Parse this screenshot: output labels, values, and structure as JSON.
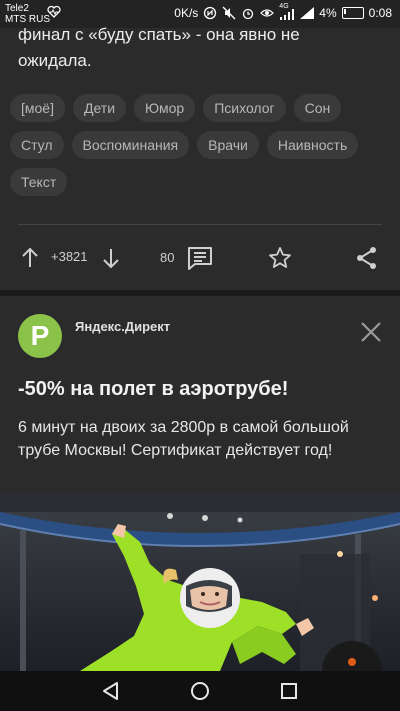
{
  "status": {
    "carrier1": "Tele2",
    "carrier2": "MTS RUS",
    "net_speed": "0K/s",
    "network_type": "4G",
    "battery_pct": "4%",
    "time": "0:08"
  },
  "article": {
    "text_line1": "финал с «буду спать» - она явно не",
    "text_line2": "ожидала.",
    "tags": [
      "[моё]",
      "Дети",
      "Юмор",
      "Психолог",
      "Сон",
      "Стул",
      "Воспоминания",
      "Врачи",
      "Наивность",
      "Текст"
    ],
    "rating": "+3821",
    "comments": "80"
  },
  "ad": {
    "logo_letter": "P",
    "source": "Яндекс.Директ",
    "title": "-50% на полет в аэротрубе!",
    "body": "6 минут на двоих за 2800р в самой большой трубе Москвы! Сертификат действует год!"
  },
  "colors": {
    "background": "#1c1c1c",
    "card": "#2b2b2b",
    "tag_bg": "#3a3a3a",
    "accent_green": "#8bc34a",
    "suit_green": "#9ee028"
  }
}
